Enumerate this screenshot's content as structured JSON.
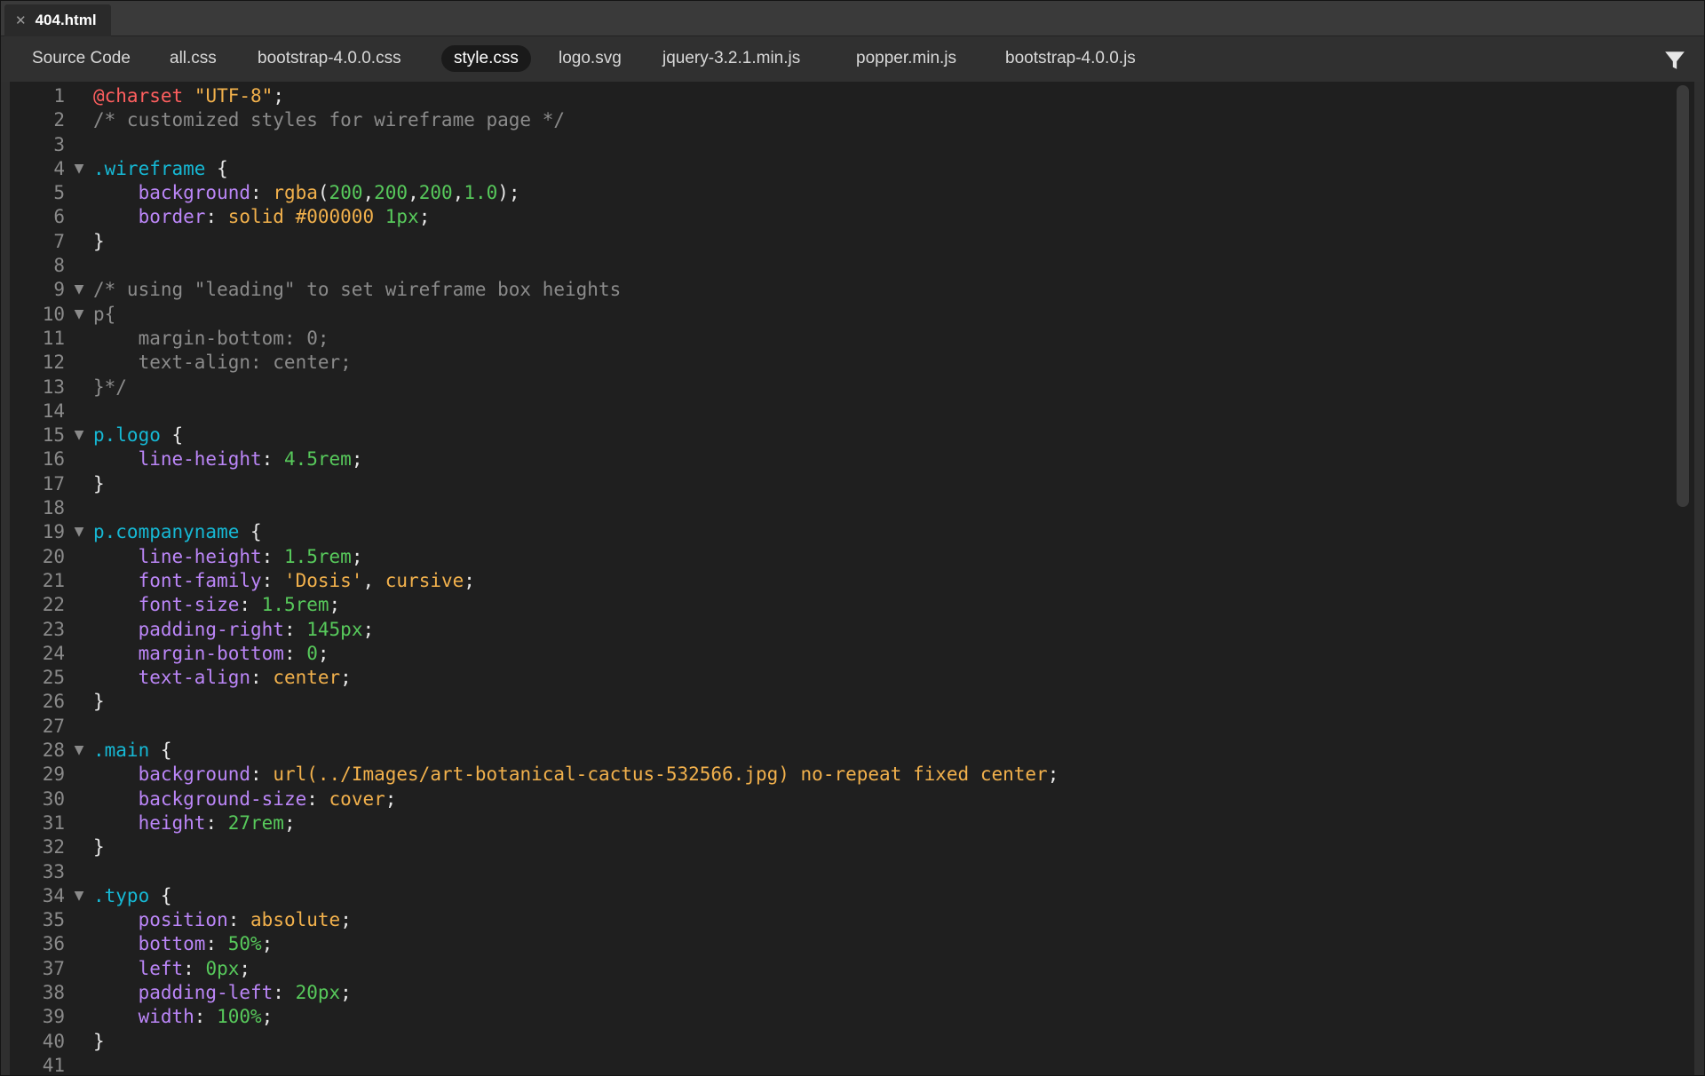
{
  "document_tab": {
    "close_glyph": "✕",
    "file_name": "404.html"
  },
  "related_files": {
    "items": [
      {
        "label": "Source Code",
        "active": false
      },
      {
        "label": "all.css",
        "active": false
      },
      {
        "label": "bootstrap-4.0.0.css",
        "active": false
      },
      {
        "label": "style.css",
        "active": true
      },
      {
        "label": "logo.svg",
        "active": false
      },
      {
        "label": "jquery-3.2.1.min.js",
        "active": false
      },
      {
        "label": "popper.min.js",
        "active": false
      },
      {
        "label": "bootstrap-4.0.0.js",
        "active": false
      }
    ],
    "filter_icon": "filter-icon"
  },
  "editor": {
    "fold_glyph": "▼",
    "lines": [
      {
        "n": "1",
        "fold": false,
        "tokens": [
          [
            "at",
            "@charset"
          ],
          [
            "punc",
            " "
          ],
          [
            "str",
            "\"UTF-8\""
          ],
          [
            "punc",
            ";"
          ]
        ]
      },
      {
        "n": "2",
        "fold": false,
        "tokens": [
          [
            "cmt",
            "/* customized styles for wireframe page */"
          ]
        ]
      },
      {
        "n": "3",
        "fold": false,
        "tokens": []
      },
      {
        "n": "4",
        "fold": true,
        "tokens": [
          [
            "sel",
            ".wireframe"
          ],
          [
            "punc",
            " {"
          ]
        ]
      },
      {
        "n": "5",
        "fold": false,
        "tokens": [
          [
            "punc",
            "    "
          ],
          [
            "prop",
            "background"
          ],
          [
            "punc",
            ": "
          ],
          [
            "val",
            "rgba"
          ],
          [
            "punc",
            "("
          ],
          [
            "num",
            "200"
          ],
          [
            "punc",
            ","
          ],
          [
            "num",
            "200"
          ],
          [
            "punc",
            ","
          ],
          [
            "num",
            "200"
          ],
          [
            "punc",
            ","
          ],
          [
            "num",
            "1.0"
          ],
          [
            "punc",
            ");"
          ]
        ]
      },
      {
        "n": "6",
        "fold": false,
        "tokens": [
          [
            "punc",
            "    "
          ],
          [
            "prop",
            "border"
          ],
          [
            "punc",
            ": "
          ],
          [
            "val",
            "solid #000000 "
          ],
          [
            "num",
            "1px"
          ],
          [
            "punc",
            ";"
          ]
        ]
      },
      {
        "n": "7",
        "fold": false,
        "tokens": [
          [
            "punc",
            "}"
          ]
        ]
      },
      {
        "n": "8",
        "fold": false,
        "tokens": []
      },
      {
        "n": "9",
        "fold": true,
        "tokens": [
          [
            "cmt",
            "/* using \"leading\" to set wireframe box heights"
          ]
        ]
      },
      {
        "n": "10",
        "fold": true,
        "tokens": [
          [
            "cmt",
            "p{"
          ]
        ]
      },
      {
        "n": "11",
        "fold": false,
        "tokens": [
          [
            "cmt",
            "    margin-bottom: 0;"
          ]
        ]
      },
      {
        "n": "12",
        "fold": false,
        "tokens": [
          [
            "cmt",
            "    text-align: center;"
          ]
        ]
      },
      {
        "n": "13",
        "fold": false,
        "tokens": [
          [
            "cmt",
            "}*/"
          ]
        ]
      },
      {
        "n": "14",
        "fold": false,
        "tokens": []
      },
      {
        "n": "15",
        "fold": true,
        "tokens": [
          [
            "sel",
            "p.logo"
          ],
          [
            "punc",
            " {"
          ]
        ]
      },
      {
        "n": "16",
        "fold": false,
        "tokens": [
          [
            "punc",
            "    "
          ],
          [
            "prop",
            "line-height"
          ],
          [
            "punc",
            ": "
          ],
          [
            "num",
            "4.5rem"
          ],
          [
            "punc",
            ";"
          ]
        ]
      },
      {
        "n": "17",
        "fold": false,
        "tokens": [
          [
            "punc",
            "}"
          ]
        ]
      },
      {
        "n": "18",
        "fold": false,
        "tokens": []
      },
      {
        "n": "19",
        "fold": true,
        "tokens": [
          [
            "sel",
            "p.companyname"
          ],
          [
            "punc",
            " {"
          ]
        ]
      },
      {
        "n": "20",
        "fold": false,
        "tokens": [
          [
            "punc",
            "    "
          ],
          [
            "prop",
            "line-height"
          ],
          [
            "punc",
            ": "
          ],
          [
            "num",
            "1.5rem"
          ],
          [
            "punc",
            ";"
          ]
        ]
      },
      {
        "n": "21",
        "fold": false,
        "tokens": [
          [
            "punc",
            "    "
          ],
          [
            "prop",
            "font-family"
          ],
          [
            "punc",
            ": "
          ],
          [
            "str",
            "'Dosis'"
          ],
          [
            "punc",
            ", "
          ],
          [
            "val",
            "cursive"
          ],
          [
            "punc",
            ";"
          ]
        ]
      },
      {
        "n": "22",
        "fold": false,
        "tokens": [
          [
            "punc",
            "    "
          ],
          [
            "prop",
            "font-size"
          ],
          [
            "punc",
            ": "
          ],
          [
            "num",
            "1.5rem"
          ],
          [
            "punc",
            ";"
          ]
        ]
      },
      {
        "n": "23",
        "fold": false,
        "tokens": [
          [
            "punc",
            "    "
          ],
          [
            "prop",
            "padding-right"
          ],
          [
            "punc",
            ": "
          ],
          [
            "num",
            "145px"
          ],
          [
            "punc",
            ";"
          ]
        ]
      },
      {
        "n": "24",
        "fold": false,
        "tokens": [
          [
            "punc",
            "    "
          ],
          [
            "prop",
            "margin-bottom"
          ],
          [
            "punc",
            ": "
          ],
          [
            "num",
            "0"
          ],
          [
            "punc",
            ";"
          ]
        ]
      },
      {
        "n": "25",
        "fold": false,
        "tokens": [
          [
            "punc",
            "    "
          ],
          [
            "prop",
            "text-align"
          ],
          [
            "punc",
            ": "
          ],
          [
            "val",
            "center"
          ],
          [
            "punc",
            ";"
          ]
        ]
      },
      {
        "n": "26",
        "fold": false,
        "tokens": [
          [
            "punc",
            "}"
          ]
        ]
      },
      {
        "n": "27",
        "fold": false,
        "tokens": []
      },
      {
        "n": "28",
        "fold": true,
        "tokens": [
          [
            "sel",
            ".main"
          ],
          [
            "punc",
            " {"
          ]
        ]
      },
      {
        "n": "29",
        "fold": false,
        "tokens": [
          [
            "punc",
            "    "
          ],
          [
            "prop",
            "background"
          ],
          [
            "punc",
            ": "
          ],
          [
            "val",
            "url(../Images/art-botanical-cactus-532566.jpg) no-repeat fixed center"
          ],
          [
            "punc",
            ";"
          ]
        ]
      },
      {
        "n": "30",
        "fold": false,
        "tokens": [
          [
            "punc",
            "    "
          ],
          [
            "prop",
            "background-size"
          ],
          [
            "punc",
            ": "
          ],
          [
            "val",
            "cover"
          ],
          [
            "punc",
            ";"
          ]
        ]
      },
      {
        "n": "31",
        "fold": false,
        "tokens": [
          [
            "punc",
            "    "
          ],
          [
            "prop",
            "height"
          ],
          [
            "punc",
            ": "
          ],
          [
            "num",
            "27rem"
          ],
          [
            "punc",
            ";"
          ]
        ]
      },
      {
        "n": "32",
        "fold": false,
        "tokens": [
          [
            "punc",
            "}"
          ]
        ]
      },
      {
        "n": "33",
        "fold": false,
        "tokens": []
      },
      {
        "n": "34",
        "fold": true,
        "tokens": [
          [
            "sel",
            ".typo"
          ],
          [
            "punc",
            " {"
          ]
        ]
      },
      {
        "n": "35",
        "fold": false,
        "tokens": [
          [
            "punc",
            "    "
          ],
          [
            "prop",
            "position"
          ],
          [
            "punc",
            ": "
          ],
          [
            "val",
            "absolute"
          ],
          [
            "punc",
            ";"
          ]
        ]
      },
      {
        "n": "36",
        "fold": false,
        "tokens": [
          [
            "punc",
            "    "
          ],
          [
            "prop",
            "bottom"
          ],
          [
            "punc",
            ": "
          ],
          [
            "num",
            "50%"
          ],
          [
            "punc",
            ";"
          ]
        ]
      },
      {
        "n": "37",
        "fold": false,
        "tokens": [
          [
            "punc",
            "    "
          ],
          [
            "prop",
            "left"
          ],
          [
            "punc",
            ": "
          ],
          [
            "num",
            "0px"
          ],
          [
            "punc",
            ";"
          ]
        ]
      },
      {
        "n": "38",
        "fold": false,
        "tokens": [
          [
            "punc",
            "    "
          ],
          [
            "prop",
            "padding-left"
          ],
          [
            "punc",
            ": "
          ],
          [
            "num",
            "20px"
          ],
          [
            "punc",
            ";"
          ]
        ]
      },
      {
        "n": "39",
        "fold": false,
        "tokens": [
          [
            "punc",
            "    "
          ],
          [
            "prop",
            "width"
          ],
          [
            "punc",
            ": "
          ],
          [
            "num",
            "100%"
          ],
          [
            "punc",
            ";"
          ]
        ]
      },
      {
        "n": "40",
        "fold": false,
        "tokens": [
          [
            "punc",
            "}"
          ]
        ]
      },
      {
        "n": "41",
        "fold": false,
        "tokens": []
      }
    ]
  },
  "colors": {
    "background": "#1f1f1f",
    "at_rule": "#ff5f5f",
    "string": "#f2b14c",
    "comment": "#8b8b8b",
    "selector": "#16b8d4",
    "property": "#bb86f7",
    "number": "#57c95b"
  }
}
